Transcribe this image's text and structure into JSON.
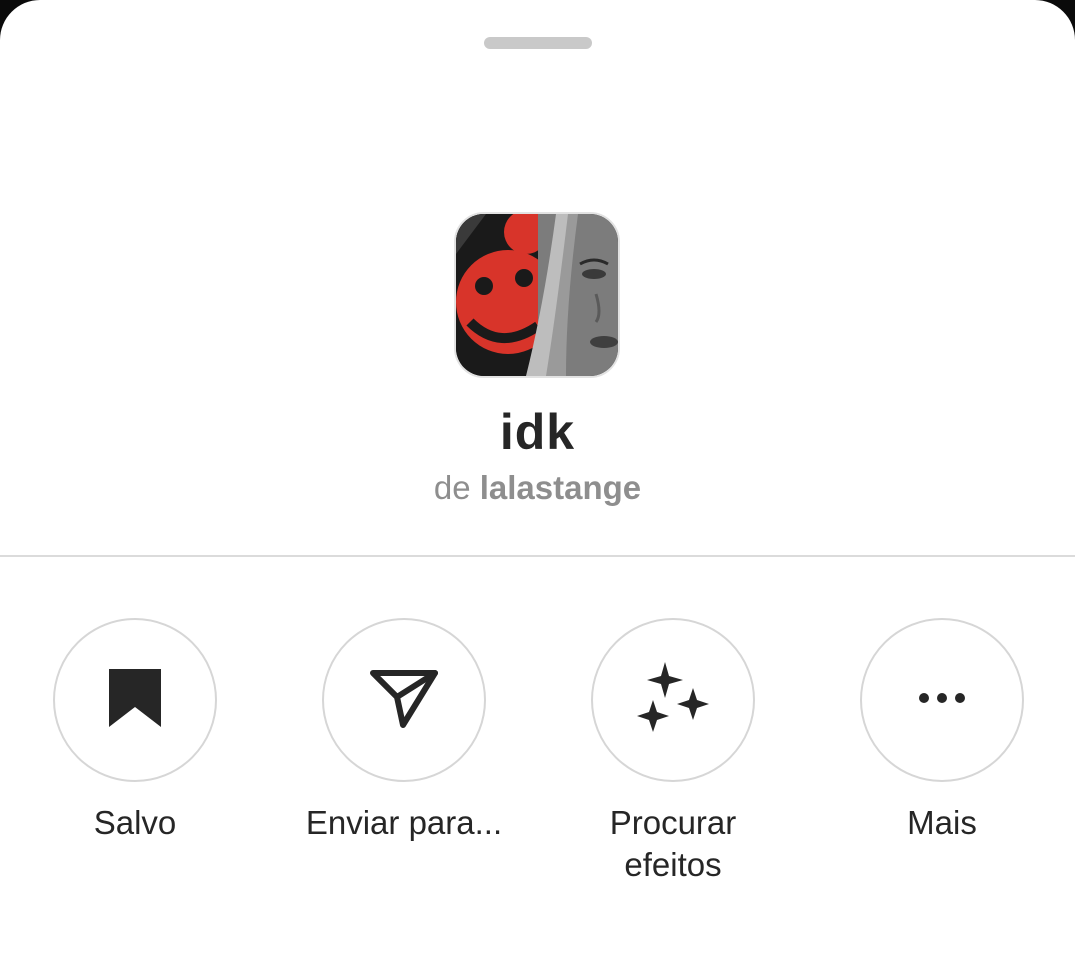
{
  "effect": {
    "name": "idk",
    "byline_prefix": "de",
    "author": "lalastange"
  },
  "actions": [
    {
      "label": "Salvo",
      "icon": "bookmark-filled-icon"
    },
    {
      "label": "Enviar para...",
      "icon": "send-icon"
    },
    {
      "label": "Procurar\nefeitos",
      "icon": "sparkles-icon"
    },
    {
      "label": "Mais",
      "icon": "more-horizontal-icon"
    }
  ],
  "colors": {
    "sheet_background": "#ffffff",
    "text_primary": "#262626",
    "text_secondary": "#8e8e8e",
    "divider": "#dbdbdb",
    "circle_border": "#d6d6d6"
  }
}
